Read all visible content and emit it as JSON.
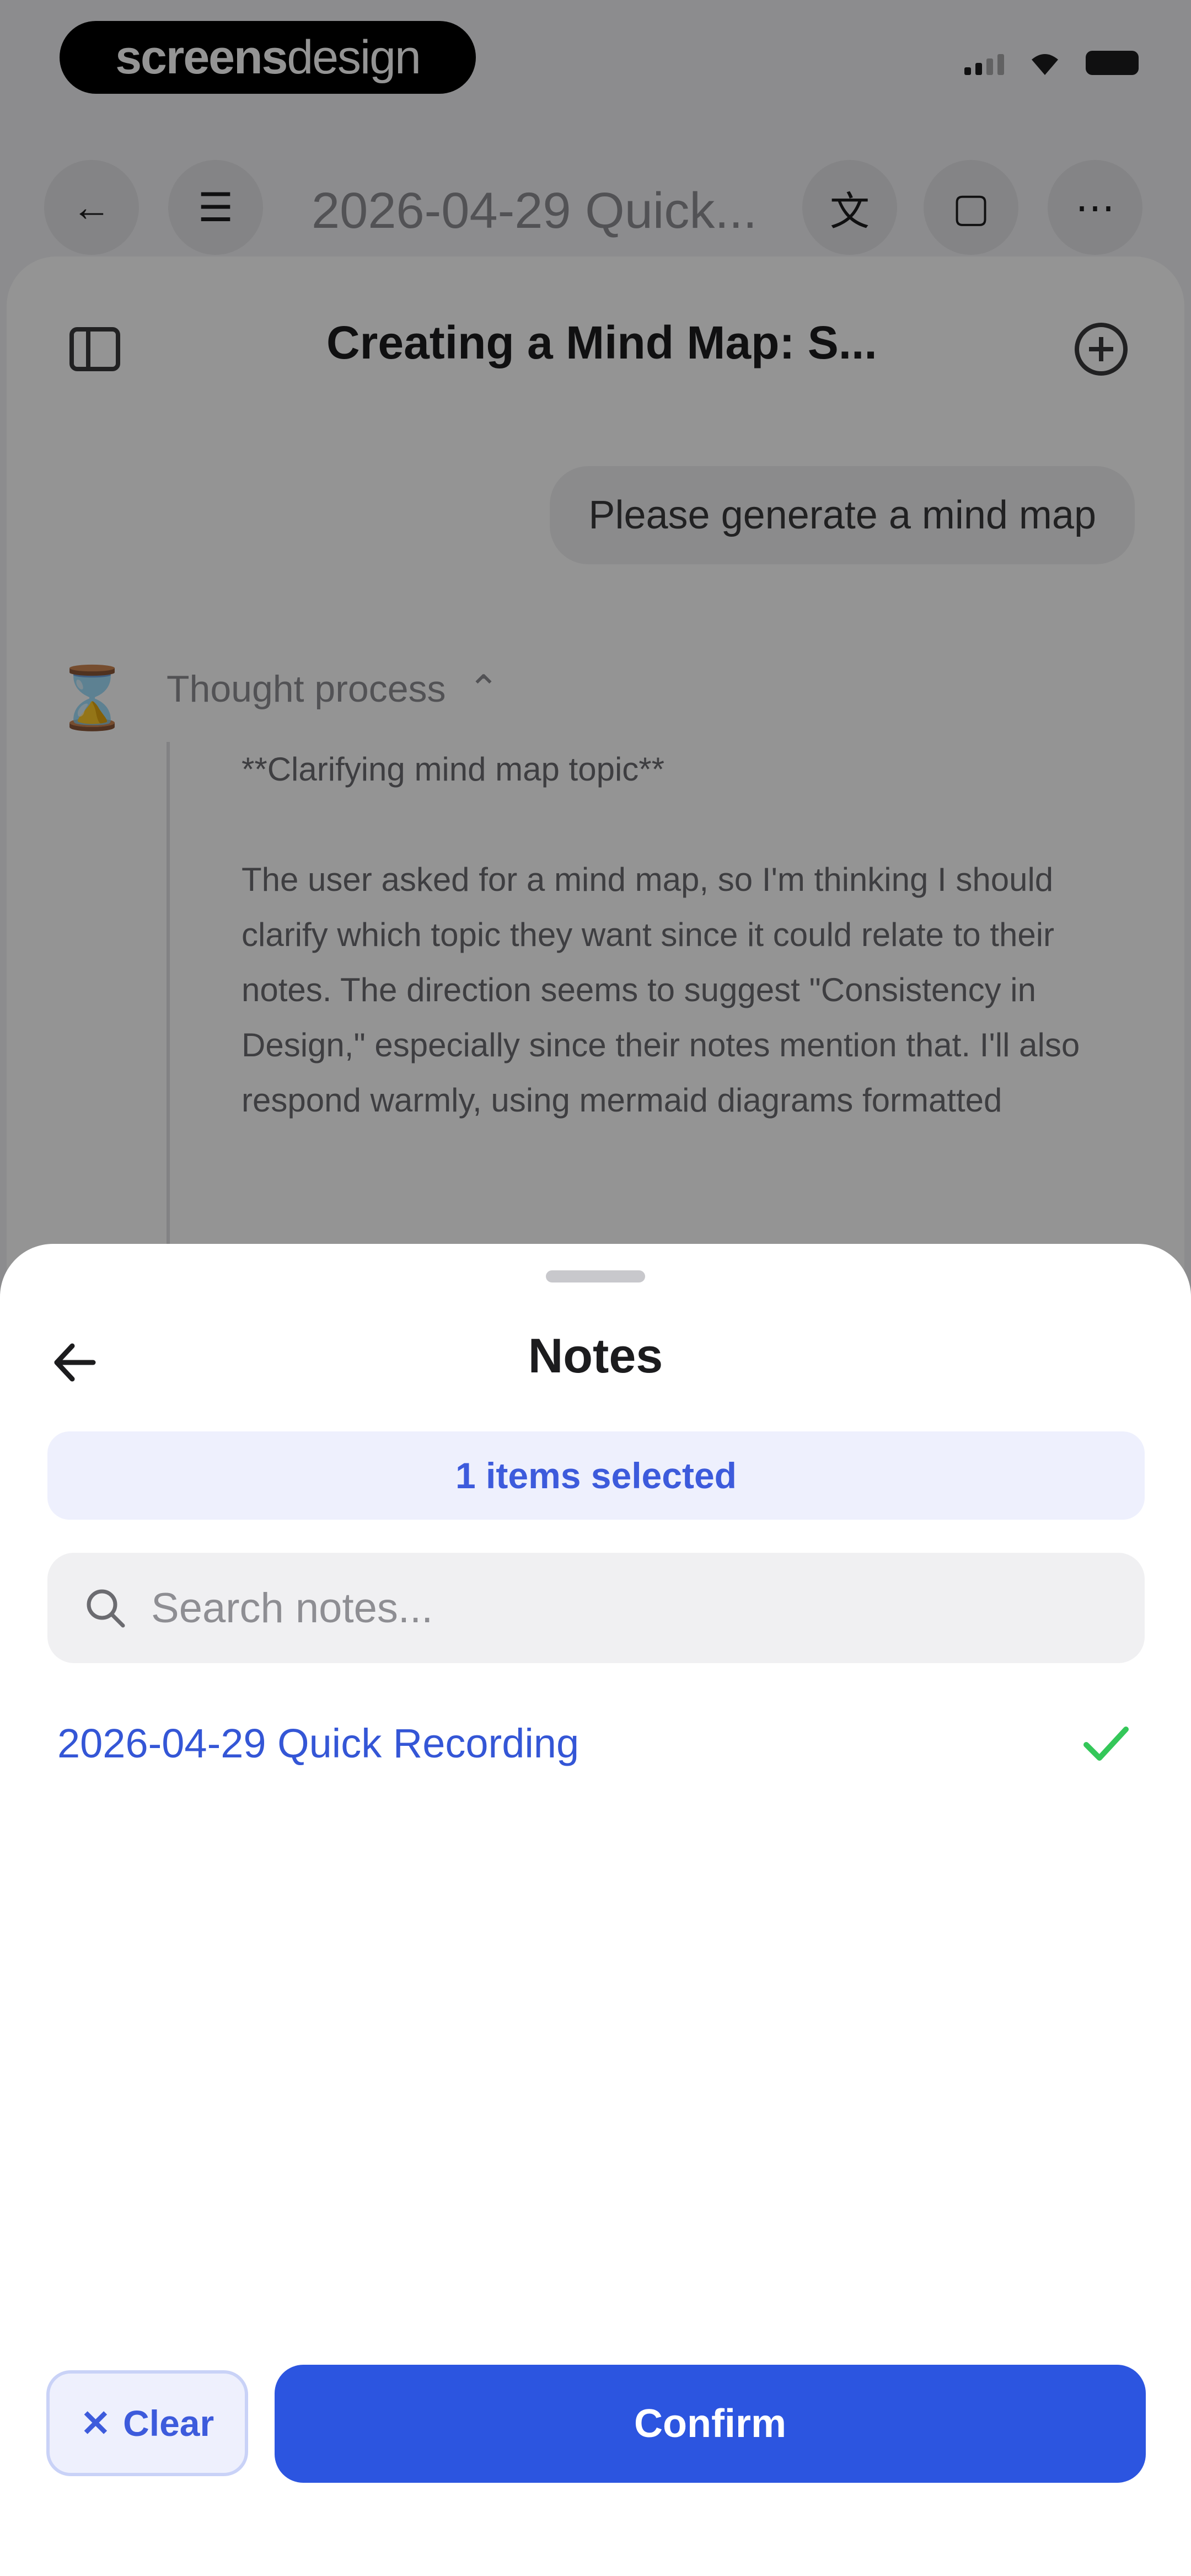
{
  "status_bar": {
    "brand_bold": "screens",
    "brand_light": "design"
  },
  "toolbar": {
    "title": "2026-04-29 Quick..."
  },
  "chat": {
    "title": "Creating a Mind Map: S...",
    "user_message": "Please generate a mind map",
    "thought_label": "Thought process",
    "thought_heading": "**Clarifying mind map topic**",
    "thought_text": "The user asked for a mind map, so I'm thinking I should clarify which topic they want since it could relate to their notes. The direction seems to suggest \"Consistency in Design,\" especially since their notes mention that. I'll also respond warmly, using mermaid diagrams formatted"
  },
  "sheet": {
    "title": "Notes",
    "selected_text": "1 items selected",
    "search": {
      "placeholder": "Search notes...",
      "value": ""
    },
    "notes": [
      {
        "title": "2026-04-29 Quick Recording",
        "selected": true
      }
    ],
    "clear_label": "Clear",
    "confirm_label": "Confirm"
  },
  "colors": {
    "accent": "#2c55e0",
    "accent_text": "#3d5bdc",
    "banner_bg": "#eef0fd",
    "check": "#34c759"
  },
  "icons": {
    "back": "arrow-left-icon",
    "search": "search-icon",
    "check": "checkmark-icon",
    "clear": "close-icon"
  }
}
